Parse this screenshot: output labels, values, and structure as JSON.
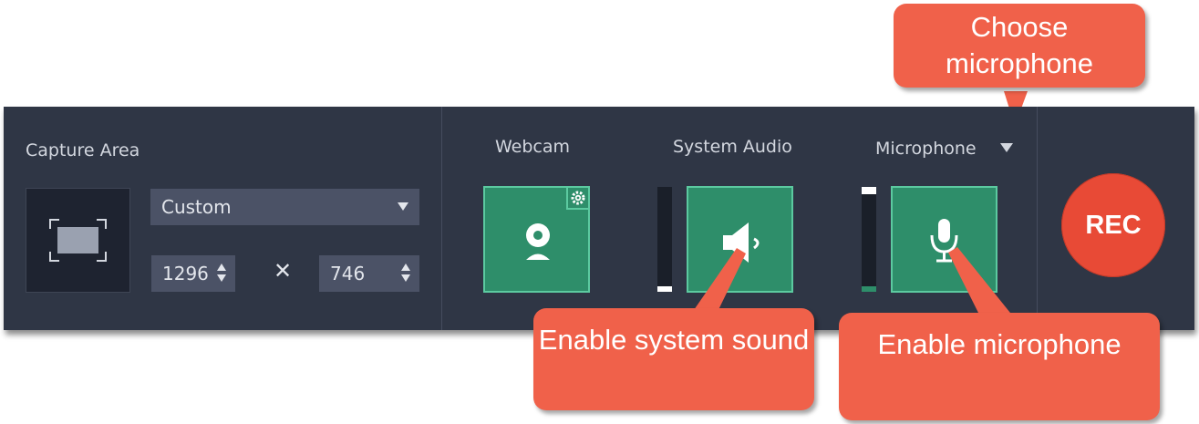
{
  "capture_area": {
    "label": "Capture Area",
    "preset": "Custom",
    "width": "1296",
    "height": "746",
    "times_symbol": "✕"
  },
  "webcam": {
    "label": "Webcam",
    "icon": "webcam-icon",
    "settings_icon": "gear-icon"
  },
  "system_audio": {
    "label": "System Audio",
    "icon": "speaker-icon",
    "level": 0.05
  },
  "microphone": {
    "label": "Microphone",
    "icon": "microphone-icon",
    "level": 0.05
  },
  "rec_button": {
    "label": "REC",
    "color": "#e84a36"
  },
  "callouts": {
    "choose_microphone": "Choose microphone",
    "enable_system_sound": "Enable system sound",
    "enable_microphone": "Enable microphone"
  },
  "colors": {
    "panel": "#2f3645",
    "tile": "#2e8e6a",
    "tile_border": "#5ccaa0",
    "callout": "#f0614a",
    "field": "#4b5266"
  }
}
